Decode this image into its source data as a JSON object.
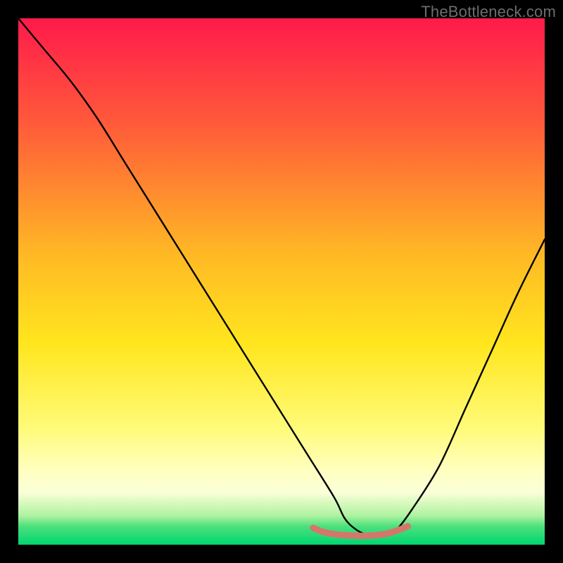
{
  "watermark": "TheBottleneck.com",
  "chart_data": {
    "type": "line",
    "title": "",
    "xlabel": "",
    "ylabel": "",
    "xlim": [
      0,
      100
    ],
    "ylim": [
      0,
      100
    ],
    "gradient_stops": [
      {
        "offset": 0.0,
        "color": "#ff1a4b"
      },
      {
        "offset": 0.2,
        "color": "#ff5a3a"
      },
      {
        "offset": 0.45,
        "color": "#ffb924"
      },
      {
        "offset": 0.62,
        "color": "#ffe61e"
      },
      {
        "offset": 0.78,
        "color": "#fffb7a"
      },
      {
        "offset": 0.86,
        "color": "#ffffc0"
      },
      {
        "offset": 0.9,
        "color": "#fbffd8"
      },
      {
        "offset": 0.945,
        "color": "#aef2a0"
      },
      {
        "offset": 0.965,
        "color": "#4de07c"
      },
      {
        "offset": 1.0,
        "color": "#00d670"
      }
    ],
    "series": [
      {
        "name": "bottleneck-curve",
        "color": "#000000",
        "x": [
          0,
          5,
          10,
          15,
          20,
          25,
          30,
          35,
          40,
          45,
          50,
          55,
          60,
          62,
          64,
          66,
          68,
          70,
          72,
          75,
          80,
          85,
          90,
          95,
          100
        ],
        "y": [
          100,
          94,
          88,
          81,
          73,
          65,
          57,
          49,
          41,
          33,
          25,
          17,
          9,
          5,
          3,
          2,
          2,
          2,
          3,
          7,
          15,
          26,
          37,
          48,
          58
        ]
      },
      {
        "name": "optimal-band",
        "color": "#d4776a",
        "x": [
          56,
          58,
          60,
          62,
          64,
          66,
          68,
          70,
          72,
          74
        ],
        "y": [
          3.2,
          2.4,
          2.0,
          1.8,
          1.7,
          1.7,
          1.8,
          2.1,
          2.7,
          3.5
        ]
      }
    ],
    "notes": "V-shaped bottleneck curve on a vertical rainbow gradient (red top → green bottom). Minimum occurs near x≈66 with y approaching the green band (optimal / no bottleneck)."
  }
}
